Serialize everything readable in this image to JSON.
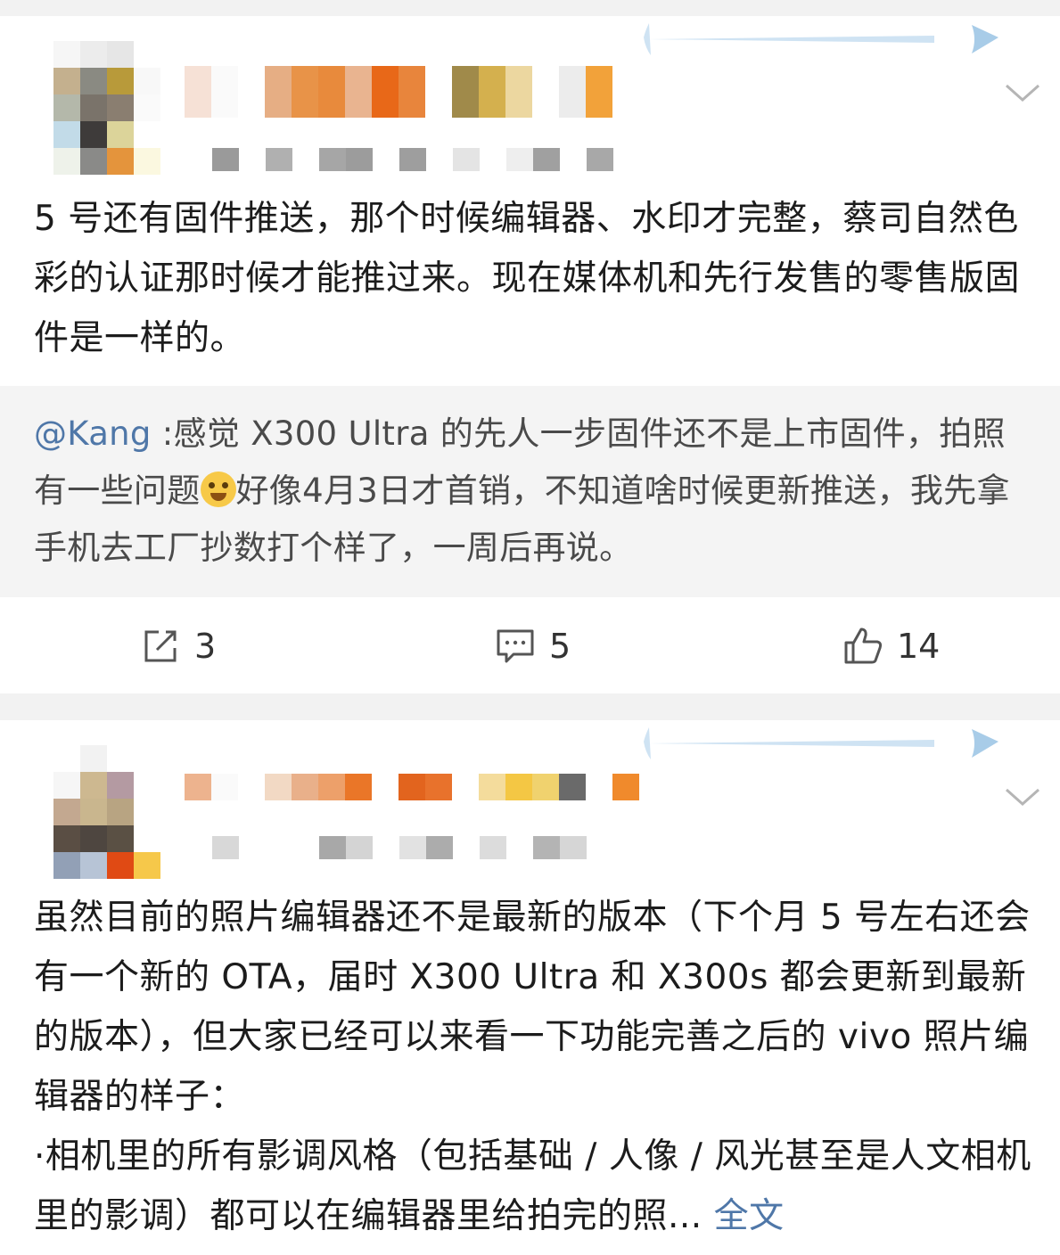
{
  "colors": {
    "page_bg": "#f2f2f2",
    "card_bg": "#ffffff",
    "retweet_bg": "#f4f4f4",
    "text": "#1c1c1c",
    "link": "#4f77a8",
    "icon": "#555555"
  },
  "posts": [
    {
      "text": "5 号还有固件推送，那个时候编辑器、水印才完整，蔡司自然色彩的认证那时候才能推过来。现在媒体机和先行发售的零售版固件是一样的。",
      "retweet": {
        "mention": "@Kang",
        "text_before_emoji": " :感觉 X300 Ultra 的先人一步固件还不是上市固件，拍照有一些问题",
        "emoji_icon": "crying-face-emoji",
        "text_after_emoji": "好像4月3日才首销，不知道啥时候更新推送，我先拿手机去工厂抄数打个样了，一周后再说。"
      },
      "actions": {
        "share_count": "3",
        "comment_count": "5",
        "like_count": "14"
      }
    },
    {
      "text": "虽然目前的照片编辑器还不是最新的版本（下个月 5 号左右还会有一个新的 OTA，届时 X300 Ultra 和 X300s 都会更新到最新的版本），但大家已经可以来看一下功能完善之后的 vivo 照片编辑器的样子：",
      "bullet": "·相机里的所有影调风格（包括基础 / 人像 / 风光甚至是人文相机里的影调）都可以在编辑器里给拍完的照...",
      "more_label": "全文"
    }
  ],
  "icons": {
    "share": "share-edit-icon",
    "comment": "comment-bubble-icon",
    "like": "thumbs-up-icon",
    "menu": "chevron-down-icon",
    "decoration": "card-decoration-icon"
  }
}
